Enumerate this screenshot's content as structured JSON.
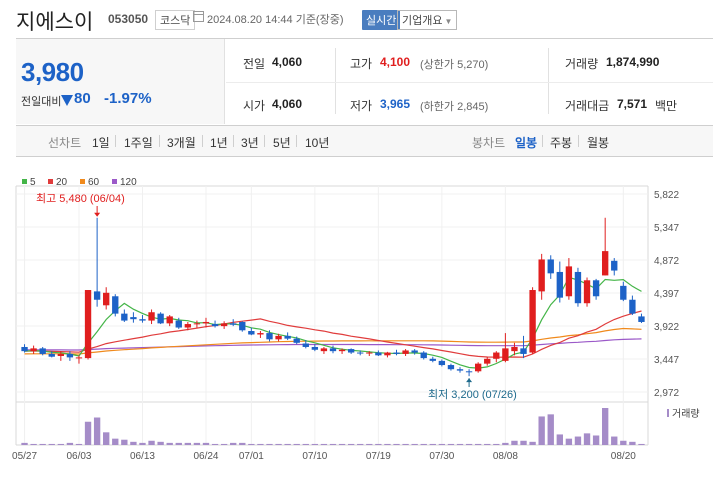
{
  "header": {
    "stock_name": "지에스이",
    "stock_code": "053050",
    "market_badge": "코스닥",
    "timestamp": "2024.08.20 14:44 기준(장중)",
    "realtime_button": "실시간",
    "company_overview_dropdown": "기업개요"
  },
  "quote": {
    "price": "3,980",
    "compare_label": "전일대비",
    "change": "80",
    "change_pct": "-1.97%",
    "direction": "down",
    "prev_close_label": "전일",
    "prev_close": "4,060",
    "open_label": "시가",
    "open": "4,060",
    "high_label": "고가",
    "high": "4,100",
    "upper_limit": "(상한가 5,270)",
    "low_label": "저가",
    "low": "3,965",
    "lower_limit": "(하한가 2,845)",
    "volume_label": "거래량",
    "volume": "1,874,990",
    "amount_label": "거래대금",
    "amount": "7,571",
    "amount_unit": "백만"
  },
  "period_bar": {
    "line_chart_label": "선차트",
    "line_periods": [
      "1일",
      "1주일",
      "3개월",
      "1년",
      "3년",
      "5년",
      "10년"
    ],
    "candle_chart_label": "봉차트",
    "candle_periods": [
      "일봉",
      "주봉",
      "월봉"
    ],
    "selected_candle_period": "일봉"
  },
  "colors": {
    "up": "#e01e1e",
    "down": "#1d62c7",
    "ma5": "#44b548",
    "ma20": "#e03c3c",
    "ma60": "#f08a1c",
    "ma120": "#9b59c8",
    "volume": "#a58cc8"
  },
  "chart_data": {
    "type": "candlestick",
    "legend": [
      {
        "name": "5",
        "color": "#44b548"
      },
      {
        "name": "20",
        "color": "#e03c3c"
      },
      {
        "name": "60",
        "color": "#f08a1c"
      },
      {
        "name": "120",
        "color": "#9b59c8"
      }
    ],
    "y_ticks": [
      "5,822",
      "5,347",
      "4,872",
      "4,397",
      "3,922",
      "3,447",
      "2,972"
    ],
    "ylim": [
      2972,
      5822
    ],
    "x_ticks": [
      "05/27",
      "06/03",
      "06/13",
      "06/24",
      "07/01",
      "07/10",
      "07/19",
      "07/30",
      "08/08",
      "08/20"
    ],
    "high_annotation": "최고 5,480 (06/04)",
    "low_annotation": "최저 3,200 (07/26)",
    "volume_label": "거래량",
    "candles": [
      {
        "o": 3620,
        "h": 3660,
        "l": 3540,
        "c": 3560
      },
      {
        "o": 3560,
        "h": 3640,
        "l": 3520,
        "c": 3600
      },
      {
        "o": 3600,
        "h": 3620,
        "l": 3500,
        "c": 3520
      },
      {
        "o": 3520,
        "h": 3560,
        "l": 3470,
        "c": 3480
      },
      {
        "o": 3490,
        "h": 3560,
        "l": 3420,
        "c": 3520
      },
      {
        "o": 3520,
        "h": 3560,
        "l": 3420,
        "c": 3470
      },
      {
        "o": 3470,
        "h": 3500,
        "l": 3380,
        "c": 3470
      },
      {
        "o": 3460,
        "h": 4440,
        "l": 3440,
        "c": 4440
      },
      {
        "o": 4420,
        "h": 5480,
        "l": 4200,
        "c": 4300
      },
      {
        "o": 4220,
        "h": 4480,
        "l": 4160,
        "c": 4400
      },
      {
        "o": 4350,
        "h": 4380,
        "l": 4060,
        "c": 4100
      },
      {
        "o": 4100,
        "h": 4160,
        "l": 3980,
        "c": 4000
      },
      {
        "o": 4050,
        "h": 4120,
        "l": 3970,
        "c": 4020
      },
      {
        "o": 4020,
        "h": 4080,
        "l": 3970,
        "c": 4000
      },
      {
        "o": 4000,
        "h": 4160,
        "l": 3950,
        "c": 4120
      },
      {
        "o": 4100,
        "h": 4120,
        "l": 3950,
        "c": 3960
      },
      {
        "o": 3960,
        "h": 4080,
        "l": 3920,
        "c": 4060
      },
      {
        "o": 4000,
        "h": 4040,
        "l": 3880,
        "c": 3900
      },
      {
        "o": 3900,
        "h": 3980,
        "l": 3860,
        "c": 3950
      },
      {
        "o": 3950,
        "h": 4000,
        "l": 3900,
        "c": 3960
      },
      {
        "o": 3960,
        "h": 4040,
        "l": 3900,
        "c": 3980
      },
      {
        "o": 3950,
        "h": 4000,
        "l": 3900,
        "c": 3920
      },
      {
        "o": 3920,
        "h": 3990,
        "l": 3880,
        "c": 3960
      },
      {
        "o": 3960,
        "h": 4020,
        "l": 3920,
        "c": 3940
      },
      {
        "o": 3980,
        "h": 3990,
        "l": 3840,
        "c": 3860
      },
      {
        "o": 3850,
        "h": 3900,
        "l": 3790,
        "c": 3800
      },
      {
        "o": 3800,
        "h": 3850,
        "l": 3750,
        "c": 3820
      },
      {
        "o": 3820,
        "h": 3860,
        "l": 3700,
        "c": 3730
      },
      {
        "o": 3730,
        "h": 3810,
        "l": 3700,
        "c": 3780
      },
      {
        "o": 3780,
        "h": 3830,
        "l": 3720,
        "c": 3740
      },
      {
        "o": 3740,
        "h": 3770,
        "l": 3660,
        "c": 3680
      },
      {
        "o": 3670,
        "h": 3720,
        "l": 3600,
        "c": 3620
      },
      {
        "o": 3620,
        "h": 3660,
        "l": 3560,
        "c": 3580
      },
      {
        "o": 3560,
        "h": 3620,
        "l": 3520,
        "c": 3600
      },
      {
        "o": 3600,
        "h": 3640,
        "l": 3530,
        "c": 3560
      },
      {
        "o": 3560,
        "h": 3600,
        "l": 3520,
        "c": 3580
      },
      {
        "o": 3590,
        "h": 3600,
        "l": 3520,
        "c": 3540
      },
      {
        "o": 3540,
        "h": 3570,
        "l": 3500,
        "c": 3530
      },
      {
        "o": 3530,
        "h": 3560,
        "l": 3490,
        "c": 3540
      },
      {
        "o": 3540,
        "h": 3570,
        "l": 3490,
        "c": 3500
      },
      {
        "o": 3500,
        "h": 3550,
        "l": 3470,
        "c": 3540
      },
      {
        "o": 3540,
        "h": 3580,
        "l": 3500,
        "c": 3520
      },
      {
        "o": 3520,
        "h": 3590,
        "l": 3490,
        "c": 3570
      },
      {
        "o": 3570,
        "h": 3590,
        "l": 3510,
        "c": 3540
      },
      {
        "o": 3540,
        "h": 3560,
        "l": 3440,
        "c": 3460
      },
      {
        "o": 3450,
        "h": 3480,
        "l": 3400,
        "c": 3420
      },
      {
        "o": 3420,
        "h": 3440,
        "l": 3340,
        "c": 3360
      },
      {
        "o": 3360,
        "h": 3380,
        "l": 3280,
        "c": 3300
      },
      {
        "o": 3300,
        "h": 3330,
        "l": 3250,
        "c": 3280
      },
      {
        "o": 3270,
        "h": 3300,
        "l": 3200,
        "c": 3260
      },
      {
        "o": 3270,
        "h": 3400,
        "l": 3250,
        "c": 3380
      },
      {
        "o": 3380,
        "h": 3480,
        "l": 3350,
        "c": 3450
      },
      {
        "o": 3450,
        "h": 3560,
        "l": 3400,
        "c": 3540
      },
      {
        "o": 3420,
        "h": 3820,
        "l": 3400,
        "c": 3600
      },
      {
        "o": 3560,
        "h": 3680,
        "l": 3500,
        "c": 3620
      },
      {
        "o": 3600,
        "h": 3780,
        "l": 3460,
        "c": 3520
      },
      {
        "o": 3540,
        "h": 4480,
        "l": 3520,
        "c": 4440
      },
      {
        "o": 4420,
        "h": 4960,
        "l": 4300,
        "c": 4880
      },
      {
        "o": 4880,
        "h": 4940,
        "l": 4600,
        "c": 4680
      },
      {
        "o": 4700,
        "h": 4850,
        "l": 4260,
        "c": 4330
      },
      {
        "o": 4350,
        "h": 4900,
        "l": 4300,
        "c": 4780
      },
      {
        "o": 4700,
        "h": 4760,
        "l": 4200,
        "c": 4250
      },
      {
        "o": 4250,
        "h": 4620,
        "l": 4200,
        "c": 4580
      },
      {
        "o": 4580,
        "h": 4600,
        "l": 4300,
        "c": 4350
      },
      {
        "o": 4650,
        "h": 5480,
        "l": 4650,
        "c": 5000
      },
      {
        "o": 4860,
        "h": 4900,
        "l": 4650,
        "c": 4720
      },
      {
        "o": 4500,
        "h": 4560,
        "l": 4280,
        "c": 4300
      },
      {
        "o": 4300,
        "h": 4360,
        "l": 4080,
        "c": 4100
      },
      {
        "o": 4060,
        "h": 4100,
        "l": 3965,
        "c": 3980
      }
    ],
    "volumes": [
      2,
      1,
      1,
      1,
      1,
      2,
      1,
      22,
      26,
      12,
      6,
      5,
      3,
      2,
      4,
      3,
      2,
      2,
      2,
      2,
      2,
      1,
      1,
      2,
      2,
      1,
      1,
      1,
      1,
      1,
      1,
      1,
      1,
      1,
      1,
      1,
      1,
      1,
      1,
      1,
      1,
      1,
      1,
      1,
      1,
      1,
      1,
      1,
      1,
      1,
      1,
      1,
      1,
      2,
      4,
      4,
      3,
      27,
      29,
      10,
      6,
      8,
      11,
      9,
      35,
      8,
      4,
      3,
      1
    ]
  }
}
